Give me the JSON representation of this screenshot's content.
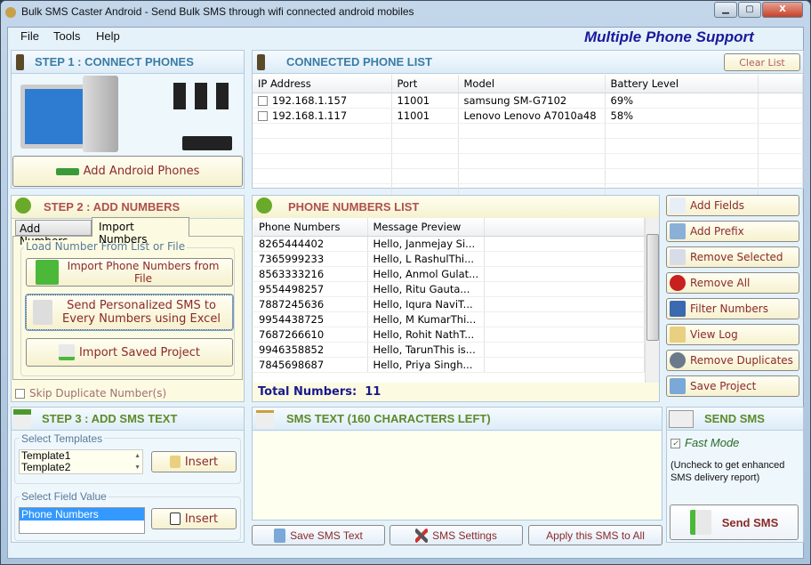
{
  "window": {
    "title": "Bulk SMS Caster Android - Send Bulk SMS through wifi connected android mobiles",
    "minimize": "▁",
    "maximize": "▢",
    "close": "X"
  },
  "menu": [
    "File",
    "Tools",
    "Help"
  ],
  "tagline": "Multiple Phone Support",
  "colors": {
    "step1": "#3a7ca5",
    "step2": "#b05050",
    "step3": "#5e8a2a",
    "button_text": "#8b2a2a",
    "total": "#1a1a8a"
  },
  "step1": {
    "title": "STEP 1 : CONNECT PHONES",
    "add_button": "Add Android Phones"
  },
  "connected": {
    "title": "CONNECTED PHONE LIST",
    "clear_button": "Clear List",
    "columns": [
      "IP Address",
      "Port",
      "Model",
      "Battery Level"
    ],
    "rows": [
      [
        "192.168.1.157",
        "11001",
        "samsung SM-G7102",
        "69%"
      ],
      [
        "192.168.1.117",
        "11001",
        "Lenovo Lenovo A7010a48",
        "58%"
      ]
    ]
  },
  "step2": {
    "title": "STEP 2 : ADD NUMBERS",
    "tabs": [
      "Add Numbers",
      "Import Numbers"
    ],
    "group": "Load Number From List or File",
    "import_file": "Import Phone Numbers from File",
    "excel": "Send Personalized SMS to Every Numbers using Excel",
    "import_project": "Import Saved Project",
    "skip_duplicates": "Skip Duplicate Number(s)"
  },
  "numbers": {
    "title": "PHONE NUMBERS LIST",
    "columns": [
      "Phone Numbers",
      "Message Preview"
    ],
    "rows": [
      [
        "8265444402",
        "Hello, Janmejay Si..."
      ],
      [
        "7365999233",
        "Hello, L RashulThi..."
      ],
      [
        "8563333216",
        "Hello, Anmol Gulat..."
      ],
      [
        "9554498257",
        "Hello, Ritu Gauta..."
      ],
      [
        "7887245636",
        "Hello, Iqura NaviT..."
      ],
      [
        "9954438725",
        "Hello, M KumarThi..."
      ],
      [
        "7687266610",
        "Hello, Rohit NathT..."
      ],
      [
        "9946358852",
        "Hello, TarunThis is..."
      ],
      [
        "7845698687",
        "Hello, Priya Singh..."
      ]
    ],
    "total_label": "Total Numbers:",
    "total": "11"
  },
  "side_buttons": [
    "Add Fields",
    "Add Prefix",
    "Remove Selected",
    "Remove All",
    "Filter Numbers",
    "View Log",
    "Remove Duplicates",
    "Save Project"
  ],
  "step3": {
    "title": "STEP 3 : ADD SMS TEXT",
    "templates_label": "Select Templates",
    "templates": [
      "Template1",
      "Template2"
    ],
    "insert": "Insert",
    "field_label": "Select Field Value",
    "fields": [
      "Phone Numbers"
    ]
  },
  "sms": {
    "title": "SMS TEXT (160 CHARACTERS LEFT)",
    "text": "",
    "save": "Save SMS Text",
    "settings": "SMS Settings",
    "apply": "Apply this SMS to All"
  },
  "send": {
    "title": "SEND SMS",
    "fast_mode": "Fast Mode",
    "fast_mode_checked": true,
    "note": "(Uncheck to get enhanced SMS delivery report)",
    "button": "Send SMS"
  }
}
